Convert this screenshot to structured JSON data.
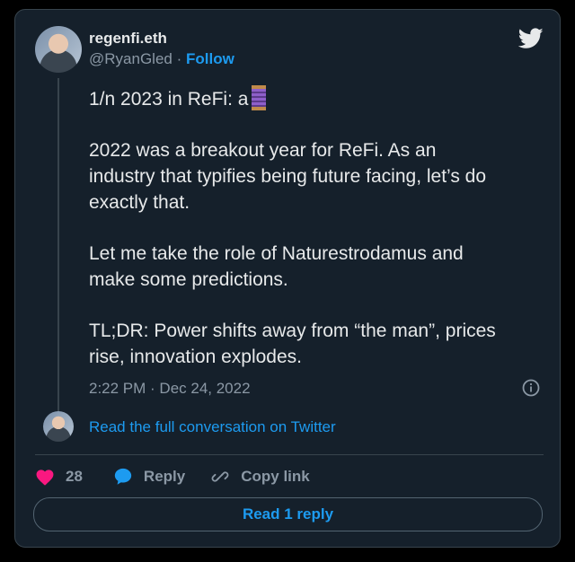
{
  "user": {
    "name": "regenfi.eth",
    "handle": "@RyanGled",
    "separator": "·",
    "follow_label": "Follow"
  },
  "tweet": {
    "paragraphs": [
      "1/n 2023 in ReFi: a",
      "2022 was a breakout year for ReFi. As an\nindustry that typifies being future facing, let’s do\nexactly that.",
      "Let me take the role of Naturestrodamus and\nmake some predictions.",
      "TL;DR: Power shifts away from “the man”, prices\nrise, innovation explodes."
    ],
    "timestamp": "2:22 PM · Dec 24, 2022"
  },
  "conversation": {
    "link_text": "Read the full conversation on Twitter"
  },
  "actions": {
    "likes": "28",
    "reply_label": "Reply",
    "copy_label": "Copy link"
  },
  "replies_button": "Read 1 reply",
  "icons": {
    "brand": "twitter-bird-icon",
    "info": "info-icon",
    "like": "heart-icon",
    "reply": "speech-bubble-icon",
    "copy": "link-icon",
    "thread": "spool-of-thread-icon"
  },
  "colors": {
    "background": "#15202b",
    "accent": "#1d9bf0",
    "heart": "#f91880",
    "muted": "#8b98a5"
  }
}
